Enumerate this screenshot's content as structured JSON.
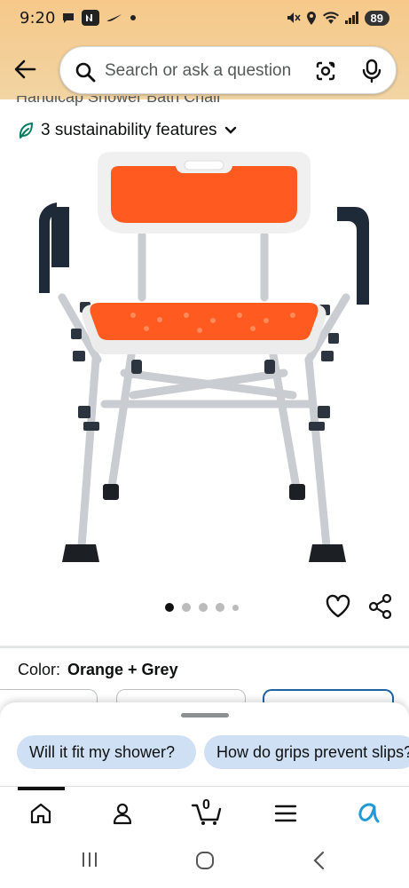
{
  "status_bar": {
    "time": "9:20",
    "battery": "89"
  },
  "search": {
    "placeholder": "Search or ask a question"
  },
  "product": {
    "title_partial": "Handicap Shower Bath Chair",
    "sustainability": "3 sustainability features",
    "image_count": 5,
    "active_image": 1
  },
  "color": {
    "label": "Color:",
    "value": "Orange + Grey"
  },
  "suggestions": [
    "Will it fit my shower?",
    "How do grips prevent slips?"
  ],
  "nav": {
    "cart_count": "0"
  },
  "colors": {
    "header_gradient_top": "#f6c98a",
    "accent_blue": "#2162a1",
    "chip_bg": "#cfe0f5",
    "seat_orange": "#ff5a1f"
  },
  "icons": [
    "back-arrow-icon",
    "search-icon",
    "lens-camera-icon",
    "mic-icon",
    "leaf-icon",
    "chevron-down-icon",
    "heart-icon",
    "share-icon",
    "home-icon",
    "account-icon",
    "cart-icon",
    "menu-icon",
    "rufus-icon"
  ]
}
